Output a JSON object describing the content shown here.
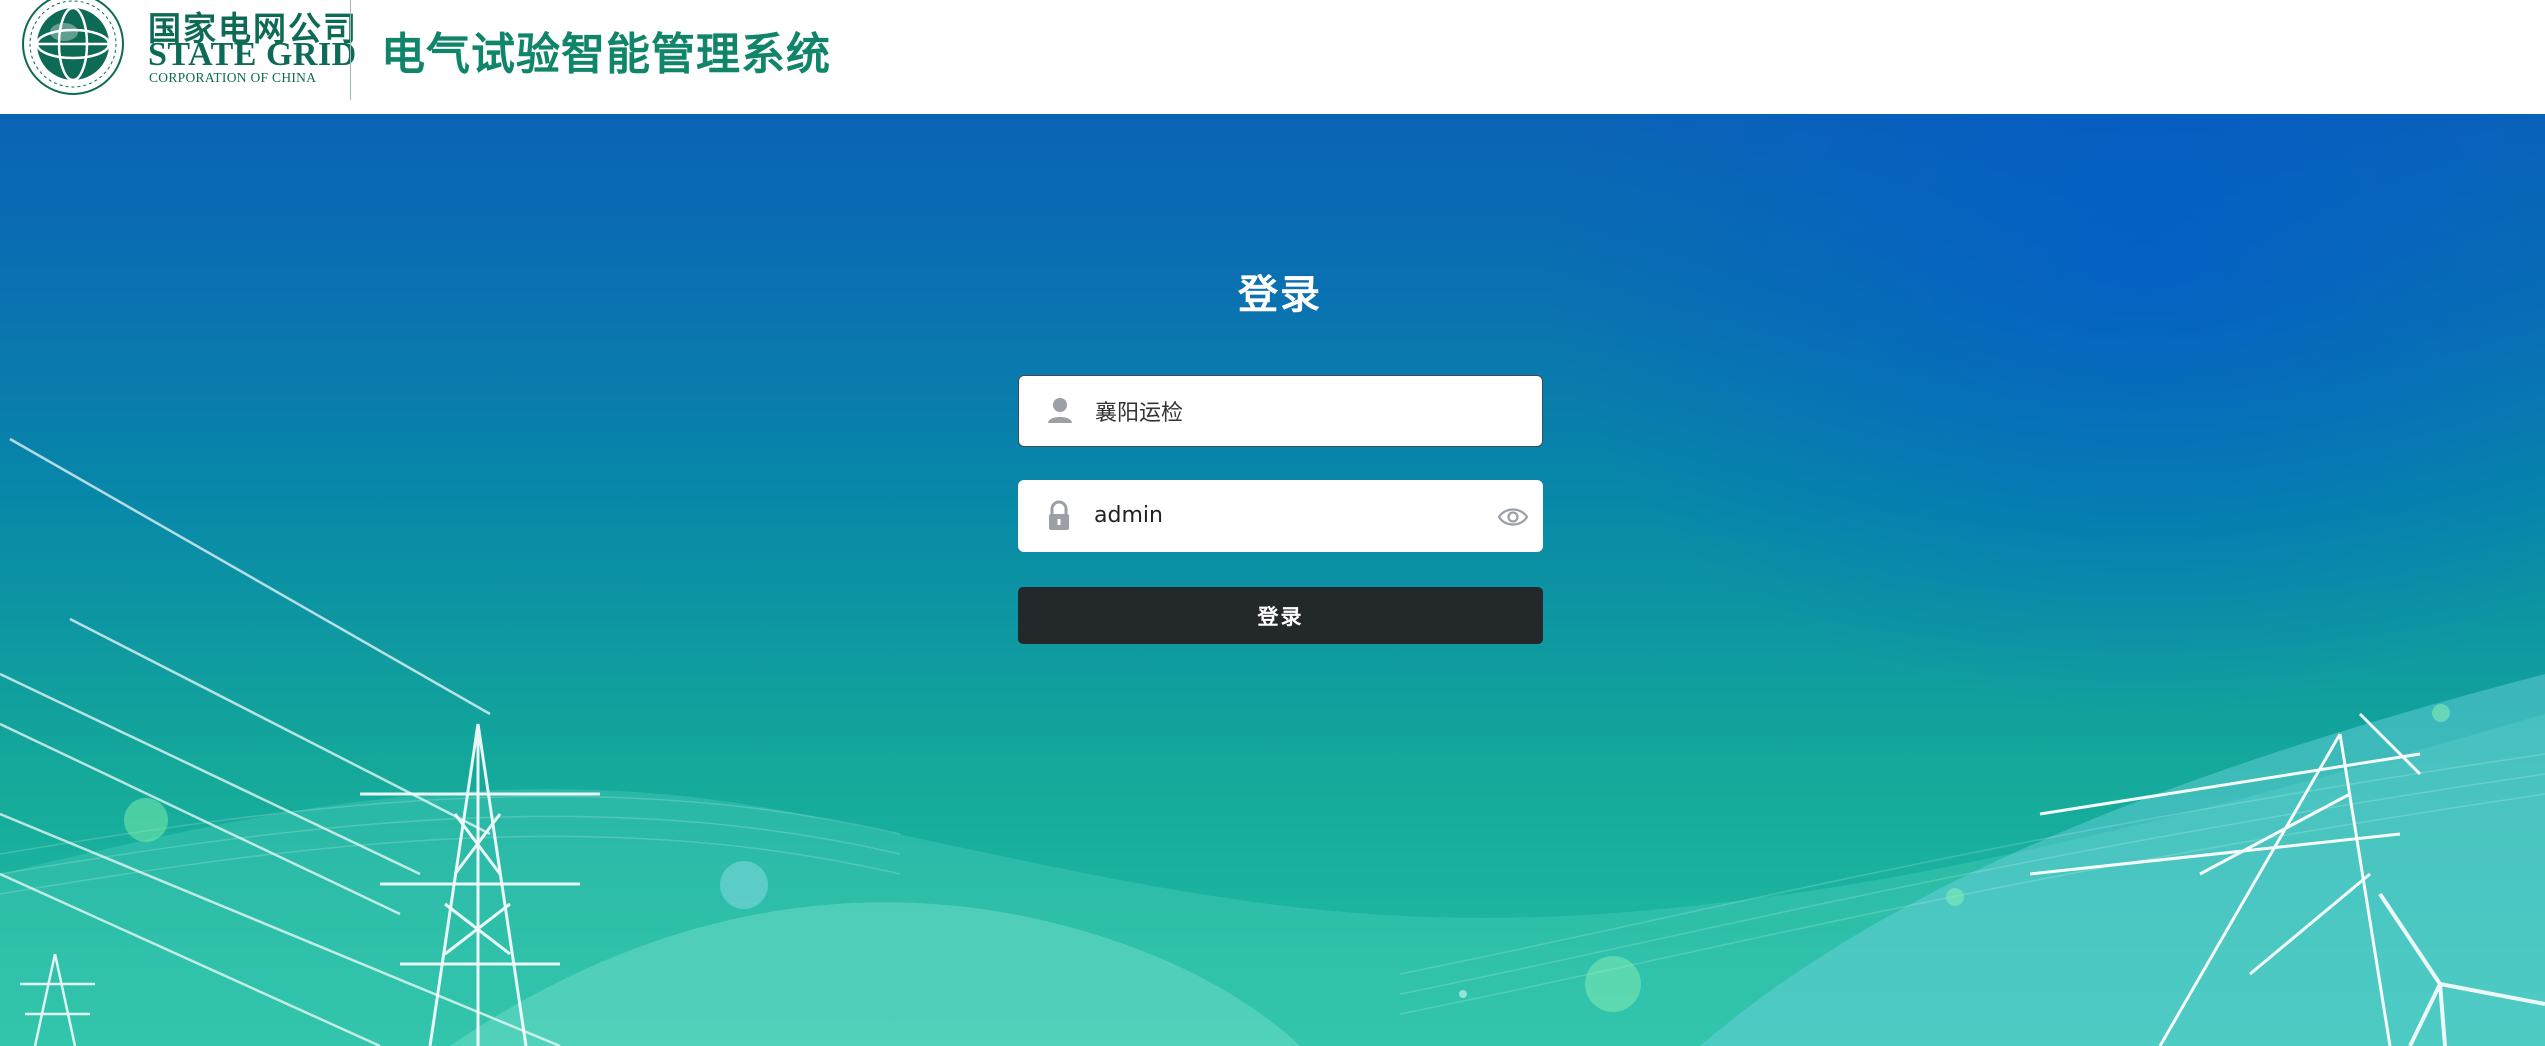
{
  "header": {
    "logo_cn": "国家电网公司",
    "logo_en": "STATE GRID",
    "logo_sub": "CORPORATION OF CHINA",
    "system_title": "电气试验智能管理系统"
  },
  "login": {
    "title": "登录",
    "username_value": "襄阳运检",
    "password_value": "admin",
    "submit_label": "登录"
  },
  "colors": {
    "brand_green": "#10856a",
    "button_dark": "#23282b"
  },
  "icons": {
    "user_field": "user-icon",
    "password_field": "lock-icon",
    "password_toggle": "eye-icon"
  }
}
